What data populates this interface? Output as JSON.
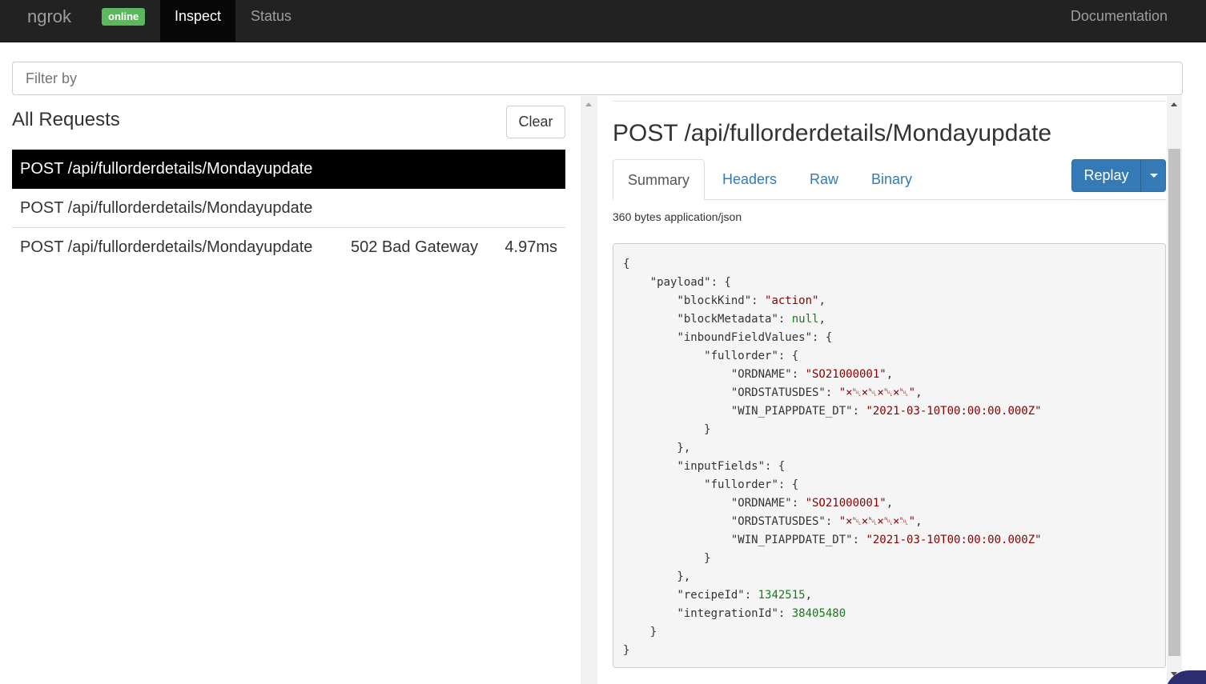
{
  "navbar": {
    "brand": "ngrok",
    "status_badge": "online",
    "tabs": [
      {
        "label": "Inspect",
        "active": true
      },
      {
        "label": "Status",
        "active": false
      }
    ],
    "docs_link": "Documentation"
  },
  "filter": {
    "placeholder": "Filter by",
    "value": ""
  },
  "requests_panel": {
    "title": "All Requests",
    "clear_label": "Clear",
    "requests": [
      {
        "method_path": "POST /api/fullorderdetails/Mondayupdate",
        "status": "",
        "duration": "",
        "selected": true
      },
      {
        "method_path": "POST /api/fullorderdetails/Mondayupdate",
        "status": "",
        "duration": "",
        "selected": false
      },
      {
        "method_path": "POST /api/fullorderdetails/Mondayupdate",
        "status": "502 Bad Gateway",
        "duration": "4.97ms",
        "selected": false
      }
    ]
  },
  "detail": {
    "title": "POST /api/fullorderdetails/Mondayupdate",
    "tabs": [
      {
        "label": "Summary",
        "active": true
      },
      {
        "label": "Headers",
        "active": false
      },
      {
        "label": "Raw",
        "active": false
      },
      {
        "label": "Binary",
        "active": false
      }
    ],
    "replay_label": "Replay",
    "meta": "360 bytes application/json",
    "json": {
      "payload_key": "\"payload\"",
      "blockKind_key": "\"blockKind\"",
      "blockKind_val": "\"action\"",
      "blockMetadata_key": "\"blockMetadata\"",
      "blockMetadata_val": "null",
      "inboundFieldValues_key": "\"inboundFieldValues\"",
      "fullorder_key": "\"fullorder\"",
      "ordname_key": "\"ORDNAME\"",
      "ordname_val": "\"SO21000001\"",
      "ordstatus_key": "\"ORDSTATUSDES\"",
      "ordstatus_val": "\"×␀×␀×␀×␀\"",
      "windate_key": "\"WIN_PIAPPDATE_DT\"",
      "windate_val": "\"2021-03-10T00:00:00.000Z\"",
      "inputFields_key": "\"inputFields\"",
      "recipeId_key": "\"recipeId\"",
      "recipeId_val": "1342515",
      "integrationId_key": "\"integrationId\"",
      "integrationId_val": "38405480"
    }
  }
}
